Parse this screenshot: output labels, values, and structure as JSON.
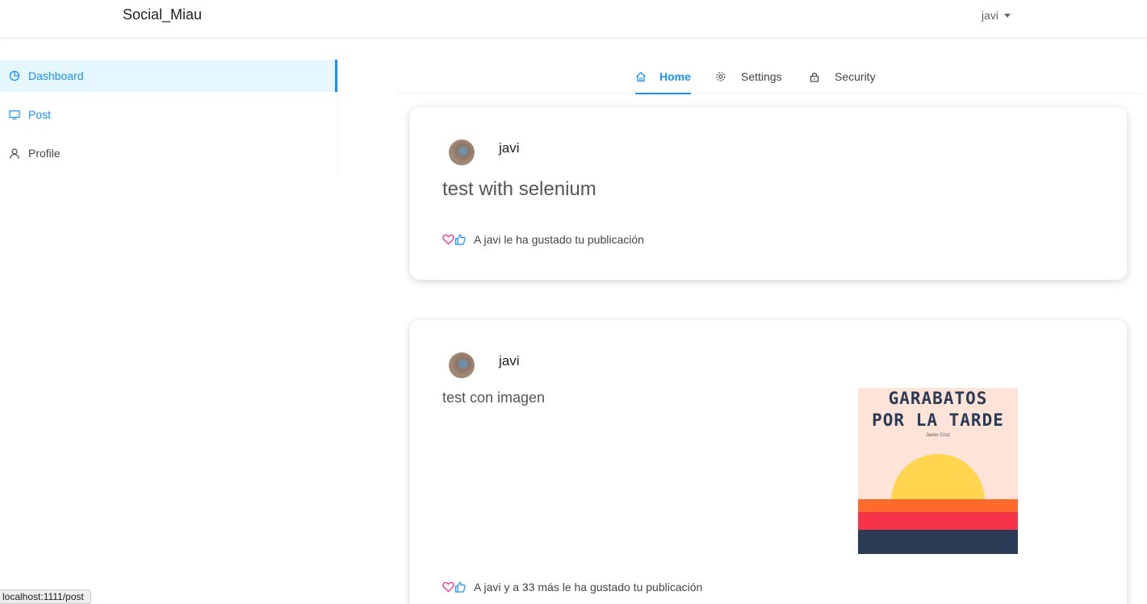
{
  "header": {
    "brand": "Social_Miau",
    "user": "javi"
  },
  "sidebar": {
    "items": [
      {
        "label": "Dashboard",
        "icon": "pie-chart-icon"
      },
      {
        "label": "Post",
        "icon": "monitor-icon"
      },
      {
        "label": "Profile",
        "icon": "user-icon"
      }
    ]
  },
  "tabs": [
    {
      "label": "Home",
      "icon": "home-icon"
    },
    {
      "label": "Settings",
      "icon": "gear-icon"
    },
    {
      "label": "Security",
      "icon": "lock-icon"
    }
  ],
  "posts": [
    {
      "user": "javi",
      "text": "test with selenium",
      "likes_text": "A javi le ha gustado tu publicación"
    },
    {
      "user": "javi",
      "text": "test con imagen",
      "likes_text": "A javi y a 33 más le ha gustado tu publicación",
      "image": {
        "title_line1": "GARABATOS",
        "title_line2": "POR LA TARDE",
        "author": "Javier Cruz"
      }
    }
  ],
  "status_bar": {
    "url": "localhost:1111/post"
  },
  "colors": {
    "accent": "#1890ff",
    "active_bg": "#e6f7ff",
    "heart": "#eb2f96"
  }
}
